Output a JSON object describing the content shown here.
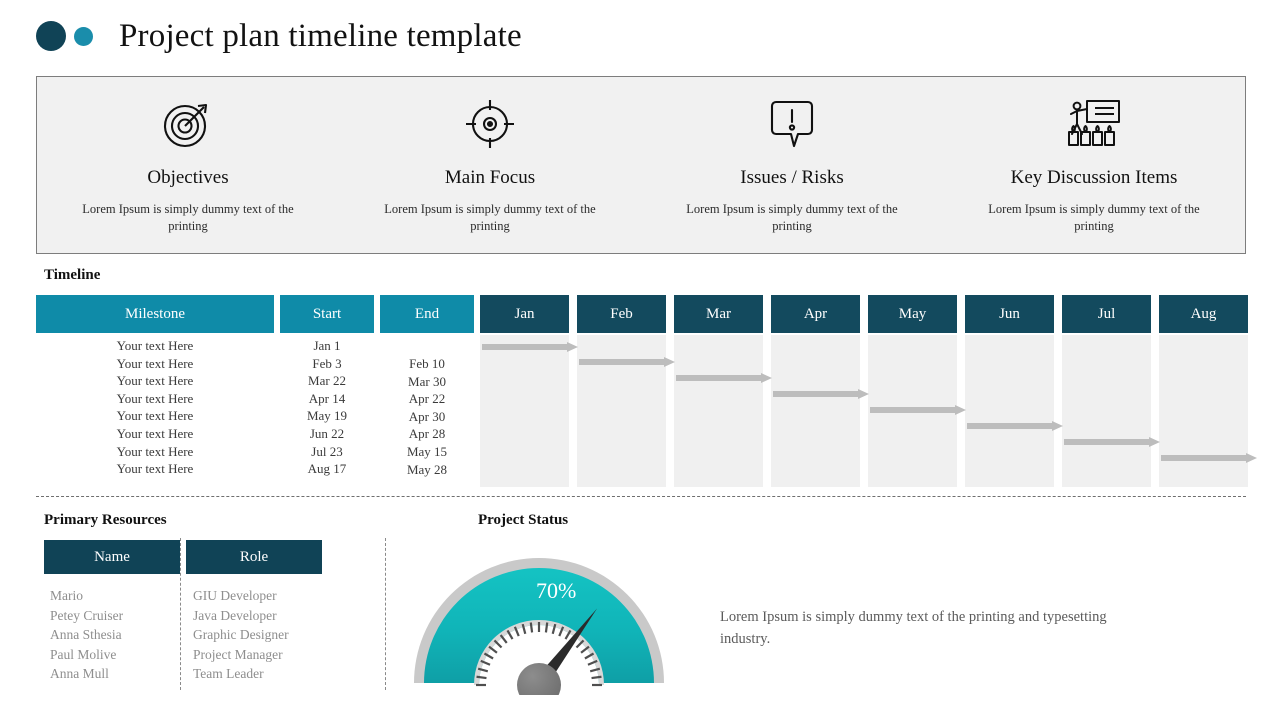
{
  "header": {
    "title": "Project plan timeline template",
    "dot_large_color": "#104356",
    "dot_small_color": "#1a8dab"
  },
  "info_panel": {
    "cards": [
      {
        "icon": "target-arrow-icon",
        "title": "Objectives",
        "desc": "Lorem Ipsum is simply dummy text of the printing"
      },
      {
        "icon": "crosshair-icon",
        "title": "Main Focus",
        "desc": "Lorem Ipsum is simply dummy text of the printing"
      },
      {
        "icon": "alert-speech-bubble-icon",
        "title": "Issues / Risks",
        "desc": "Lorem Ipsum is simply dummy text of the printing"
      },
      {
        "icon": "presentation-audience-icon",
        "title": "Key Discussion Items",
        "desc": "Lorem Ipsum is simply dummy text of the printing"
      }
    ]
  },
  "timeline": {
    "label": "Timeline",
    "headers": {
      "milestone": "Milestone",
      "start": "Start",
      "end": "End"
    },
    "months": [
      "Jan",
      "Feb",
      "Mar",
      "Apr",
      "May",
      "Jun",
      "Jul",
      "Aug"
    ],
    "milestones": [
      "Your text Here",
      "Your text Here",
      "Your text Here",
      "Your text Here",
      "Your text Here",
      "Your text Here",
      "Your text Here",
      "Your text Here"
    ],
    "start_dates": [
      "Jan 1",
      "Feb 3",
      "Mar 22",
      "Apr 14",
      "May 19",
      "Jun 22",
      "Jul 23",
      "Aug 17"
    ],
    "end_dates": [
      "Feb 10",
      "Mar 30",
      "Apr 22",
      "Apr 30",
      "Apr 28",
      "May 15",
      "May 28"
    ],
    "colors": {
      "teal_header": "#0f8ba8",
      "navy_header": "#134a5e",
      "column_bg": "#f0f0f0",
      "arrow": "#bdbdbd"
    }
  },
  "resources": {
    "label": "Primary Resources",
    "columns": [
      "Name",
      "Role"
    ],
    "rows": [
      {
        "name": "Mario",
        "role": "GIU Developer"
      },
      {
        "name": "Petey Cruiser",
        "role": "Java Developer"
      },
      {
        "name": "Anna Sthesia",
        "role": "Graphic Designer"
      },
      {
        "name": "Paul Molive",
        "role": "Project Manager"
      },
      {
        "name": "Anna Mull",
        "role": "Team Leader"
      }
    ]
  },
  "project_status": {
    "label": "Project Status",
    "percent_label": "70%",
    "percent_value": 70,
    "description": "Lorem Ipsum is simply dummy text of the printing and typesetting industry.",
    "colors": {
      "gauge_fill_outer": "#0fc0c0",
      "gauge_fill_inner": "#12a9ae",
      "rim": "#c9c9c9",
      "needle": "#2b2b2b",
      "hub": "#7c7c7c"
    }
  },
  "chart_data": {
    "type": "gauge",
    "title": "Project Status",
    "value": 70,
    "unit": "%",
    "min": 0,
    "max": 100,
    "label": "70%"
  }
}
